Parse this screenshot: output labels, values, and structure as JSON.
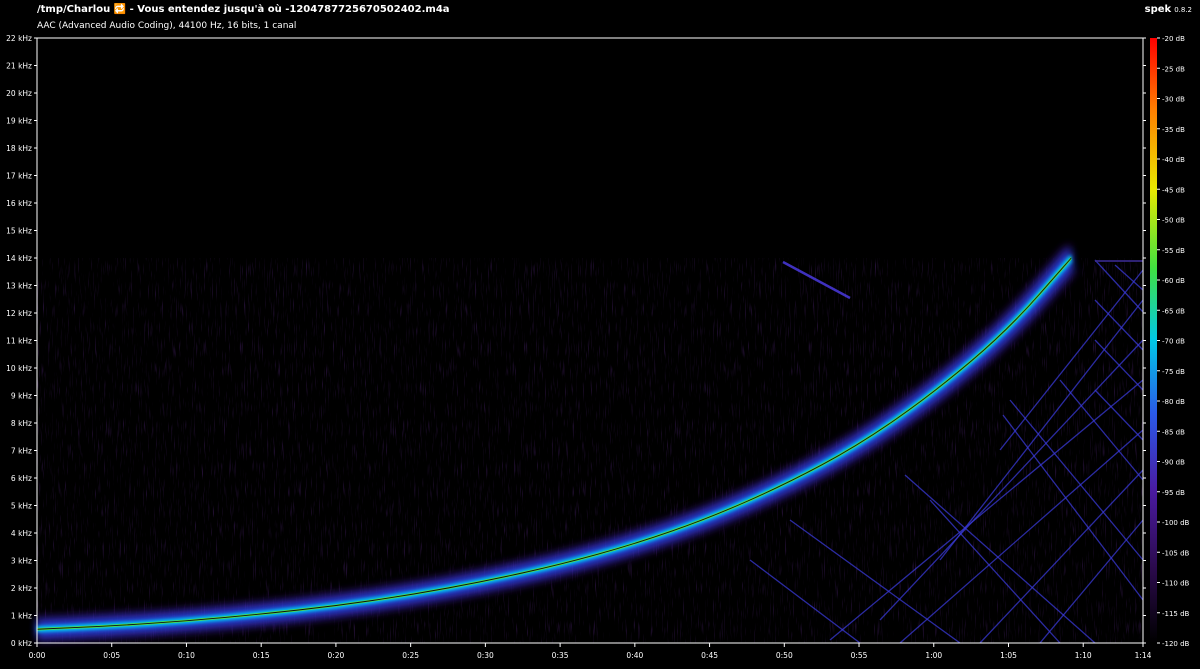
{
  "header": {
    "title": "/tmp/Charlou 🔁 - Vous entendez jusqu'à où -1204787725670502402.m4a",
    "subtitle": "AAC (Advanced Audio Coding), 44100 Hz, 16 bits, 1 canal",
    "app_name": "spek",
    "app_version": "0.8.2"
  },
  "colors": {
    "background": "#000000",
    "axis": "#ffffff",
    "palette": [
      "#000000",
      "#2a0a4a",
      "#4a1aa0",
      "#2a5ae8",
      "#00c8e8",
      "#40e040",
      "#e8e800",
      "#ff8000",
      "#ff0000"
    ]
  },
  "chart_data": {
    "type": "heatmap",
    "title": "",
    "xlabel": "",
    "ylabel": "",
    "x_ticks": [
      "0:00",
      "0:05",
      "0:10",
      "0:15",
      "0:20",
      "0:25",
      "0:30",
      "0:35",
      "0:40",
      "0:45",
      "0:50",
      "0:55",
      "1:00",
      "1:05",
      "1:10",
      "1:14"
    ],
    "x_tick_seconds": [
      0,
      5,
      10,
      15,
      20,
      25,
      30,
      35,
      40,
      45,
      50,
      55,
      60,
      65,
      70,
      74
    ],
    "xlim_seconds": [
      0,
      74
    ],
    "y_ticks": [
      "0 kHz",
      "1 kHz",
      "2 kHz",
      "3 kHz",
      "4 kHz",
      "5 kHz",
      "6 kHz",
      "7 kHz",
      "8 kHz",
      "9 kHz",
      "10 kHz",
      "11 kHz",
      "12 kHz",
      "13 kHz",
      "14 kHz",
      "15 kHz",
      "16 kHz",
      "17 kHz",
      "18 kHz",
      "19 kHz",
      "20 kHz",
      "21 kHz",
      "22 kHz"
    ],
    "ylim_khz": [
      0,
      22
    ],
    "colorbar_ticks": [
      "-20 dB",
      "-25 dB",
      "-30 dB",
      "-35 dB",
      "-40 dB",
      "-45 dB",
      "-50 dB",
      "-55 dB",
      "-60 dB",
      "-65 dB",
      "-70 dB",
      "-75 dB",
      "-80 dB",
      "-85 dB",
      "-90 dB",
      "-95 dB",
      "-100 dB",
      "-105 dB",
      "-110 dB",
      "-115 dB",
      "-120 dB"
    ],
    "colorbar_range_db": [
      -120,
      -20
    ],
    "sweep": {
      "t": [
        0,
        5,
        10,
        15,
        20,
        25,
        30,
        35,
        40,
        45,
        50,
        55,
        60,
        65,
        69.2
      ],
      "khz": [
        0.5,
        0.62,
        0.8,
        1.05,
        1.35,
        1.75,
        2.25,
        2.85,
        3.6,
        4.55,
        5.75,
        7.2,
        9.1,
        11.4,
        14.0
      ]
    },
    "noise_band_khz": 14.0,
    "lowpass_cutoff_khz": 14.0
  }
}
